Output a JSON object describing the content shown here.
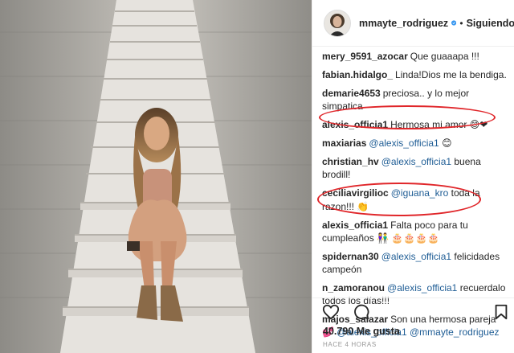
{
  "post": {
    "username": "mmayte_rodriguez",
    "separator": "•",
    "follow_status": "Siguiendo",
    "likes": "40.790 Me gusta",
    "timestamp": "HACE 4 HORAS"
  },
  "comments": [
    {
      "user": "mery_9591_azocar",
      "parts": [
        {
          "t": "Que guaaapa !!!"
        }
      ]
    },
    {
      "user": "fabian.hidalgo_",
      "parts": [
        {
          "t": "Linda!Dios me la bendiga."
        }
      ]
    },
    {
      "user": "demarie4653",
      "parts": [
        {
          "t": "preciosa.. y lo mejor simpatica"
        }
      ]
    },
    {
      "user": "alexis_officia1",
      "parts": [
        {
          "t": "Hermosa mi amor 😊❤"
        }
      ]
    },
    {
      "user": "maxiarias",
      "parts": [
        {
          "t": "@alexis_officia1",
          "m": true
        },
        {
          "t": " 😊"
        }
      ]
    },
    {
      "user": "christian_hv",
      "parts": [
        {
          "t": "@alexis_officia1",
          "m": true
        },
        {
          "t": " buena brodill!"
        }
      ]
    },
    {
      "user": "ceciliavirgilioc",
      "parts": [
        {
          "t": "@iguana_kro",
          "m": true
        },
        {
          "t": " toda la razon!!! 👏"
        }
      ]
    },
    {
      "user": "alexis_officia1",
      "parts": [
        {
          "t": "Falta poco para tu cumpleaños 👫 🎂🎂🎂🎂"
        }
      ]
    },
    {
      "user": "spidernan30",
      "parts": [
        {
          "t": "@alexis_officia1",
          "m": true
        },
        {
          "t": " felicidades campeón"
        }
      ]
    },
    {
      "user": "n_zamoranou",
      "parts": [
        {
          "t": "@alexis_officia1",
          "m": true
        },
        {
          "t": " recuerdalo todos los días!!!"
        }
      ]
    },
    {
      "user": "majos_salazar",
      "parts": [
        {
          "t": "Son una hermosa pareja 💕 "
        },
        {
          "t": "@alexis_officia1",
          "m": true
        },
        {
          "t": " "
        },
        {
          "t": "@mmayte_rodriguez",
          "m": true
        }
      ]
    }
  ],
  "colors": {
    "mention": "#1f5d95",
    "highlight": "#e0262a",
    "verified": "#3897f0"
  },
  "icons": [
    "heart-icon",
    "comment-icon",
    "bookmark-icon",
    "verified-icon"
  ]
}
